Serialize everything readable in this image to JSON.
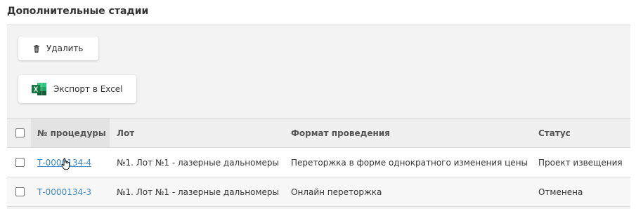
{
  "section": {
    "title": "Дополнительные стадии"
  },
  "toolbar": {
    "delete_label": "Удалить",
    "export_label": "Экспорт в Excel"
  },
  "table": {
    "headers": {
      "number": "№ процедуры",
      "lot": "Лот",
      "format": "Формат проведения",
      "status": "Статус"
    },
    "rows": [
      {
        "number": "Т-0000134-4",
        "lot": "№1. Лот №1 - лазерные дальномеры",
        "format": "Переторжка в форме однократного изменения цены",
        "status": "Проект извещения"
      },
      {
        "number": "Т-0000134-3",
        "lot": "№1. Лот №1 - лазерные дальномеры",
        "format": "Онлайн переторжка",
        "status": "Отменена"
      }
    ]
  },
  "icons": {
    "delete": "trash-icon",
    "export": "excel-icon",
    "cursor": "hand-pointer-icon"
  },
  "colors": {
    "link": "#3b86c9",
    "excel_green": "#1d6f42",
    "panel_bg": "#f3f3f3"
  }
}
